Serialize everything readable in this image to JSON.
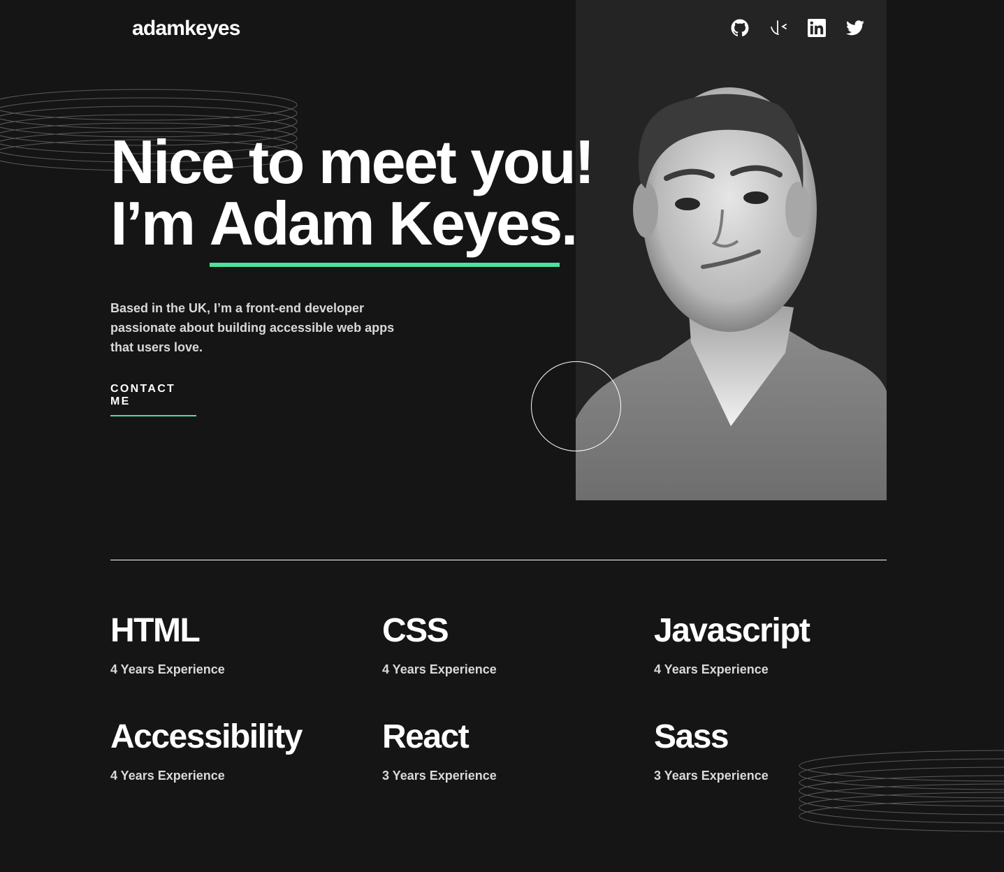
{
  "header": {
    "logo": "adamkeyes",
    "social_links": [
      {
        "name": "github",
        "icon": "github-icon"
      },
      {
        "name": "frontend-mentor",
        "icon": "frontend-mentor-icon"
      },
      {
        "name": "linkedin",
        "icon": "linkedin-icon"
      },
      {
        "name": "twitter",
        "icon": "twitter-icon"
      }
    ]
  },
  "hero": {
    "line1": "Nice to meet you!",
    "line2_prefix": "I’m ",
    "name": "Adam Keyes.",
    "intro": "Based in the UK, I’m a front-end developer passionate about building accessible web apps that users love.",
    "contact_label": "CONTACT ME",
    "photo_icon": "profile-photo"
  },
  "skills": [
    {
      "name": "HTML",
      "experience": "4 Years Experience"
    },
    {
      "name": "CSS",
      "experience": "4 Years Experience"
    },
    {
      "name": "Javascript",
      "experience": "4 Years Experience"
    },
    {
      "name": "Accessibility",
      "experience": "4 Years Experience"
    },
    {
      "name": "React",
      "experience": "3 Years Experience"
    },
    {
      "name": "Sass",
      "experience": "3 Years Experience"
    }
  ],
  "colors": {
    "background": "#151515",
    "panel": "#242424",
    "accent": "#4ee1a0",
    "text": "#ffffff",
    "muted_text": "#d9d9d9"
  }
}
